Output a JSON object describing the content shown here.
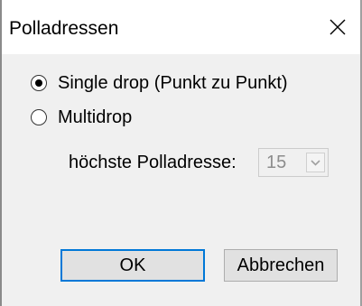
{
  "window": {
    "title": "Polladressen",
    "close_glyph": "×"
  },
  "options": {
    "single_drop_label": "Single drop (Punkt zu Punkt)",
    "single_drop_selected": true,
    "multidrop_label": "Multidrop",
    "multidrop_selected": false
  },
  "poll_address": {
    "label": "höchste Polladresse:",
    "value": "15",
    "enabled": false
  },
  "buttons": {
    "ok_label": "OK",
    "cancel_label": "Abbrechen"
  },
  "icons": {
    "close": "close-icon",
    "dropdown": "chevron-down-icon"
  },
  "colors": {
    "dialog_background": "#f0f0f0",
    "title_background": "#ffffff",
    "disabled_text": "#8c8c8c",
    "default_button_border": "#0078d7"
  }
}
